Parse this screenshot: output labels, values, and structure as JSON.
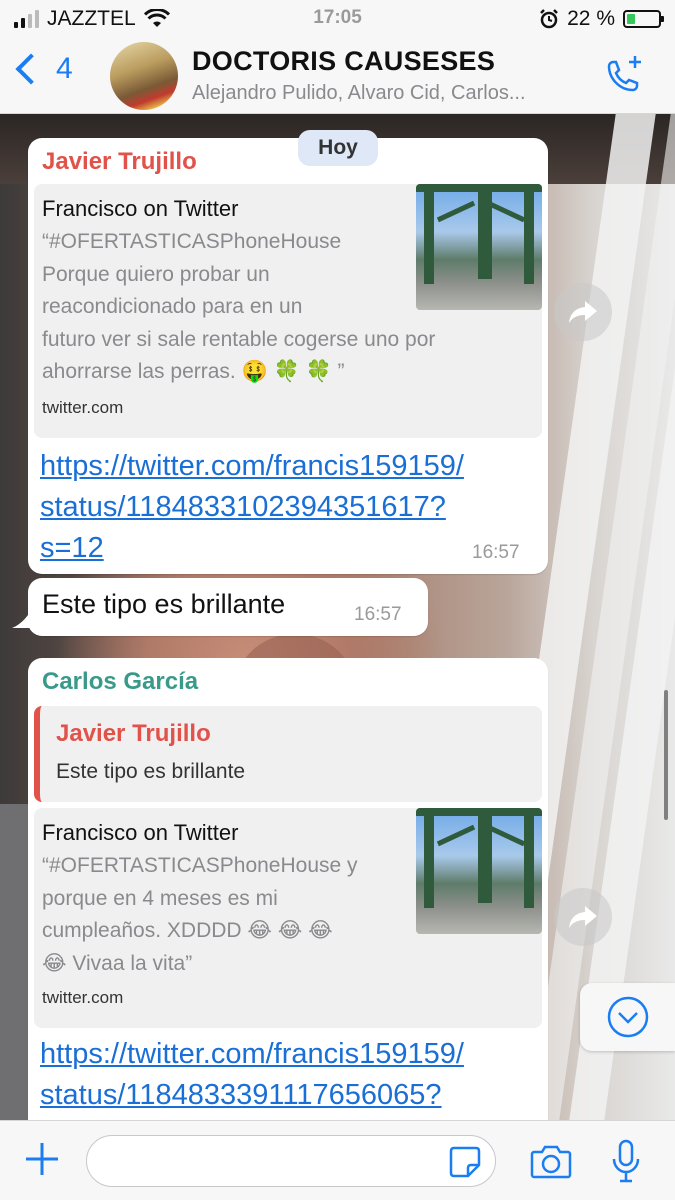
{
  "status_bar": {
    "carrier": "JAZZTEL",
    "time": "17:05",
    "battery": "22 %"
  },
  "header": {
    "back_count": "4",
    "title": "DOCTORIS CAUSESES",
    "subtitle": "Alejandro Pulido, Alvaro Cid, Carlos..."
  },
  "date_badge": "Hoy",
  "messages": [
    {
      "sender": "Javier Trujillo",
      "preview": {
        "title": "Francisco on Twitter",
        "desc_lines": [
          "“#OFERTASTICASPhoneHouse",
          "Porque quiero probar un",
          "reacondicionado para en un",
          "futuro ver si sale rentable cogerse uno por",
          "ahorrarse las perras. 🤑 🍀 🍀 ”"
        ],
        "domain": "twitter.com"
      },
      "link_lines": [
        "https://twitter.com/francis159159/",
        "status/1184833102394351617?",
        "s=12"
      ],
      "time": "16:57"
    },
    {
      "text": "Este tipo es brillante",
      "time": "16:57"
    },
    {
      "sender": "Carlos García",
      "quote": {
        "name": "Javier Trujillo",
        "text": "Este tipo es brillante"
      },
      "preview": {
        "title": "Francisco on Twitter",
        "desc_lines": [
          "“#OFERTASTICASPhoneHouse y",
          "porque en 4 meses es mi",
          "cumpleaños. XDDDD 😂 😂 😂",
          "😂  Vivaa la vita”"
        ],
        "domain": "twitter.com"
      },
      "link_lines": [
        "https://twitter.com/francis159159/",
        "status/1184833391117656065?"
      ]
    }
  ],
  "composer": {
    "placeholder": ""
  },
  "colors": {
    "accent": "#1a7ef2",
    "sender1": "#e0524a",
    "sender2": "#3a9a8a",
    "link": "#1a6fd6"
  }
}
